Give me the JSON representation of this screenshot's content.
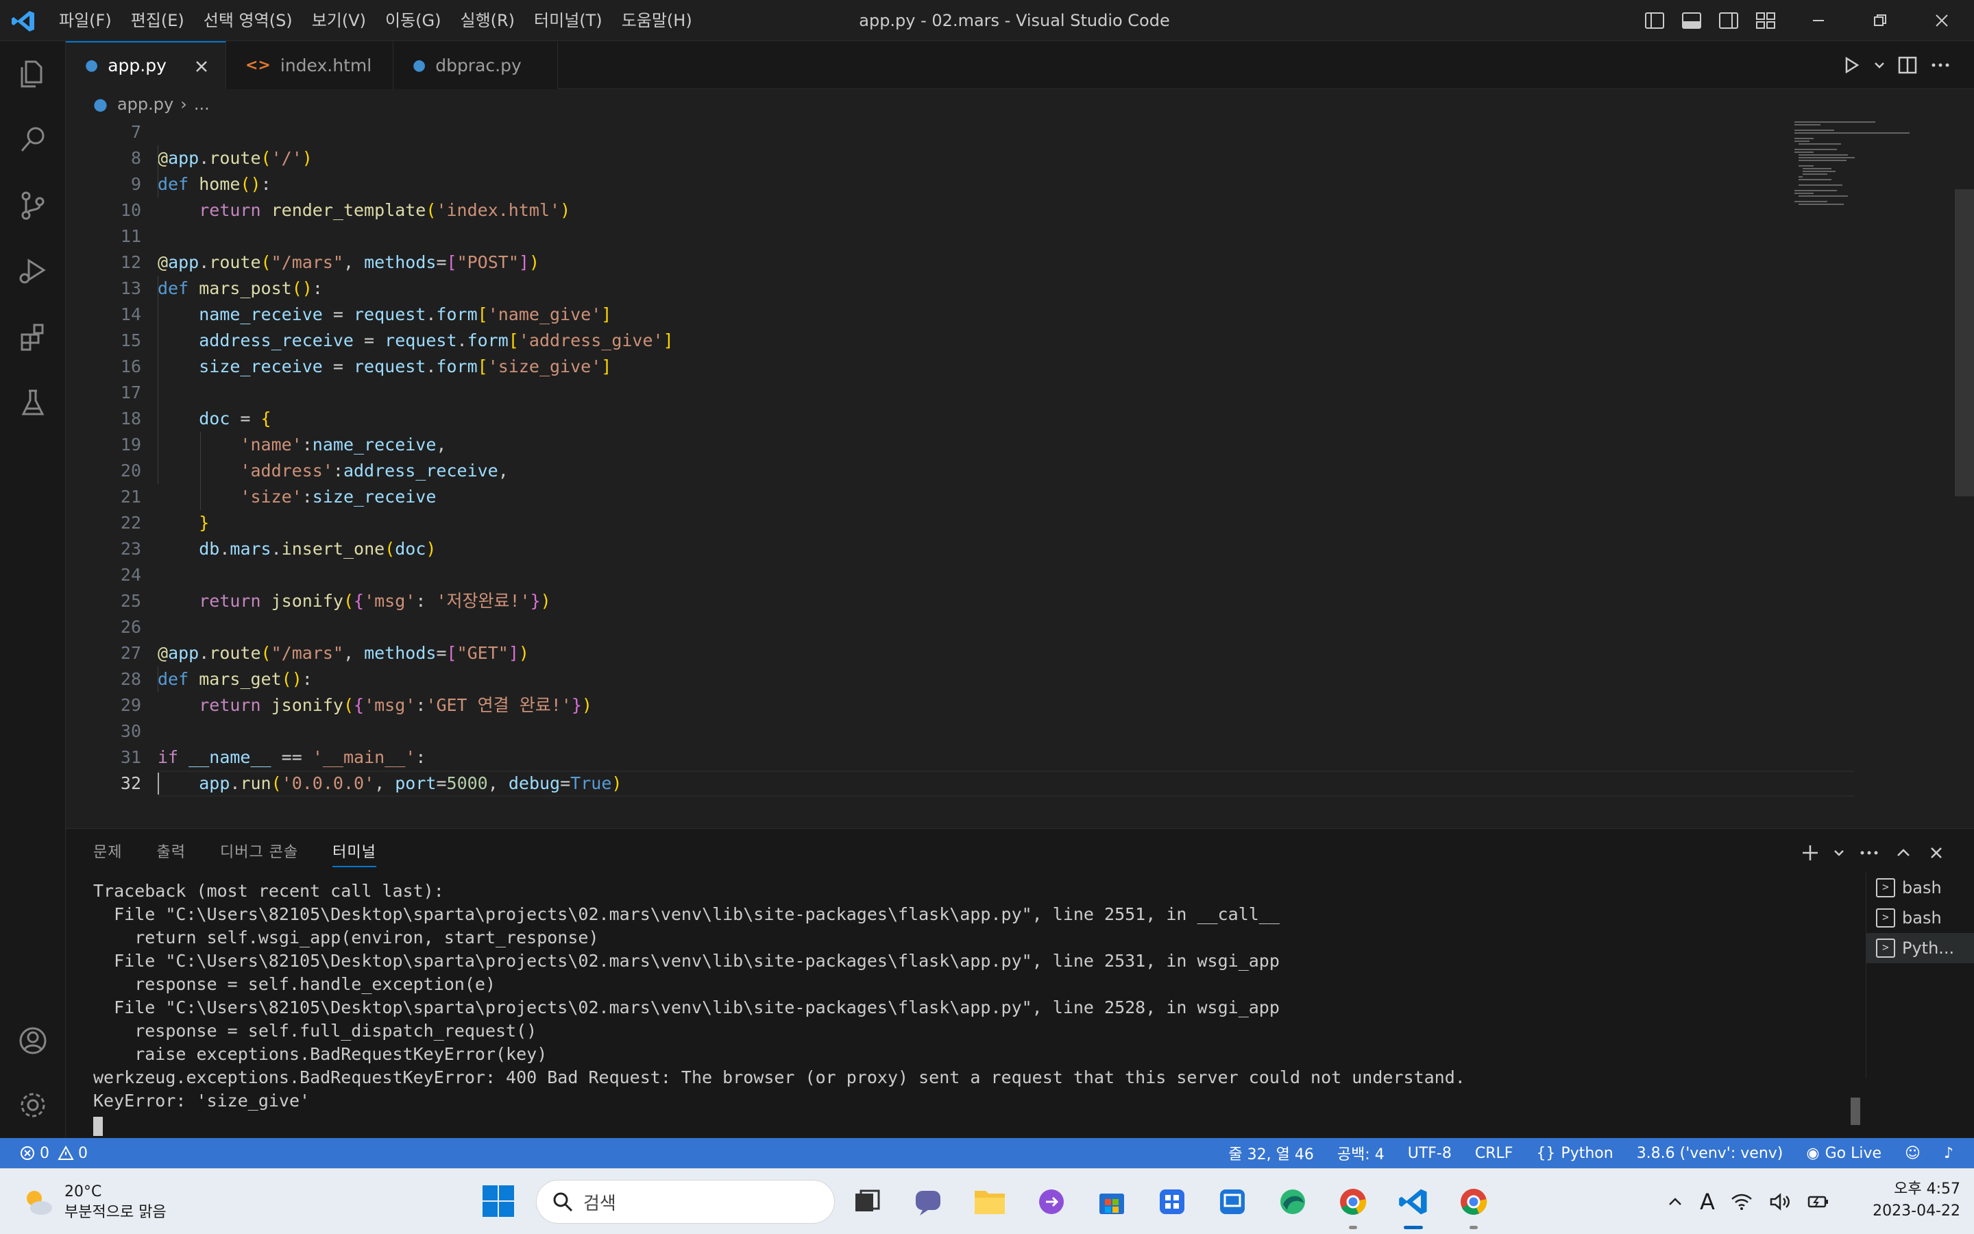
{
  "titlebar": {
    "menu": [
      "파일(F)",
      "편집(E)",
      "선택 영역(S)",
      "보기(V)",
      "이동(G)",
      "실행(R)",
      "터미널(T)",
      "도움말(H)"
    ],
    "title": "app.py - 02.mars - Visual Studio Code"
  },
  "activitybar": {
    "icons": [
      "explorer-icon",
      "search-icon",
      "source-control-icon",
      "run-debug-icon",
      "extensions-icon",
      "testing-icon",
      "account-icon",
      "manage-gear-icon"
    ]
  },
  "tabs": [
    {
      "label": "app.py",
      "icon": "python-file-icon",
      "active": true
    },
    {
      "label": "index.html",
      "icon": "html-file-icon",
      "active": false
    },
    {
      "label": "dbprac.py",
      "icon": "python-file-icon",
      "active": false
    }
  ],
  "breadcrumb": {
    "file": "app.py",
    "rest": "..."
  },
  "editor": {
    "line_numbers": [
      "7",
      "8",
      "9",
      "10",
      "11",
      "12",
      "13",
      "14",
      "15",
      "16",
      "17",
      "18",
      "19",
      "20",
      "21",
      "22",
      "23",
      "24",
      "25",
      "26",
      "27",
      "28",
      "29",
      "30",
      "31",
      "32"
    ],
    "current_line": "32",
    "lines": [
      "",
      "@app.route('/')",
      "def home():",
      "    return render_template('index.html')",
      "",
      "@app.route(\"/mars\", methods=[\"POST\"])",
      "def mars_post():",
      "    name_receive = request.form['name_give']",
      "    address_receive = request.form['address_give']",
      "    size_receive = request.form['size_give']",
      "",
      "    doc = {",
      "        'name':name_receive,",
      "        'address':address_receive,",
      "        'size':size_receive",
      "    }",
      "    db.mars.insert_one(doc)",
      "",
      "    return jsonify({'msg': '저장완료!'})",
      "",
      "@app.route(\"/mars\", methods=[\"GET\"])",
      "def mars_get():",
      "    return jsonify({'msg':'GET 연결 완료!'})",
      "",
      "if __name__ == '__main__':",
      "    app.run('0.0.0.0', port=5000, debug=True)"
    ]
  },
  "panel": {
    "tabs": [
      "문제",
      "출력",
      "디버그 콘솔",
      "터미널"
    ],
    "active_tab": "터미널",
    "terminal_lines": [
      "Traceback (most recent call last):",
      "  File \"C:\\Users\\82105\\Desktop\\sparta\\projects\\02.mars\\venv\\lib\\site-packages\\flask\\app.py\", line 2551, in __call__",
      "    return self.wsgi_app(environ, start_response)",
      "  File \"C:\\Users\\82105\\Desktop\\sparta\\projects\\02.mars\\venv\\lib\\site-packages\\flask\\app.py\", line 2531, in wsgi_app",
      "    response = self.handle_exception(e)",
      "  File \"C:\\Users\\82105\\Desktop\\sparta\\projects\\02.mars\\venv\\lib\\site-packages\\flask\\app.py\", line 2528, in wsgi_app",
      "    response = self.full_dispatch_request()",
      "    raise exceptions.BadRequestKeyError(key)",
      "werkzeug.exceptions.BadRequestKeyError: 400 Bad Request: The browser (or proxy) sent a request that this server could not understand.",
      "KeyError: 'size_give'"
    ],
    "terminals": [
      "bash",
      "bash",
      "Pyth..."
    ]
  },
  "statusbar": {
    "errors": "0",
    "warnings": "0",
    "position": "줄 32, 열 46",
    "spaces": "공백: 4",
    "encoding": "UTF-8",
    "eol": "CRLF",
    "language": "Python",
    "interpreter": "3.8.6 ('venv': venv)",
    "golive": "Go Live"
  },
  "taskbar": {
    "weather_temp": "20°C",
    "weather_desc": "부분적으로 맑음",
    "search_placeholder": "검색",
    "time": "오후 4:57",
    "date": "2023-04-22",
    "ime": "A"
  },
  "colors": {
    "accent": "#0078d4",
    "statusbar": "#3574d0",
    "editor_bg": "#1f1f1f"
  }
}
